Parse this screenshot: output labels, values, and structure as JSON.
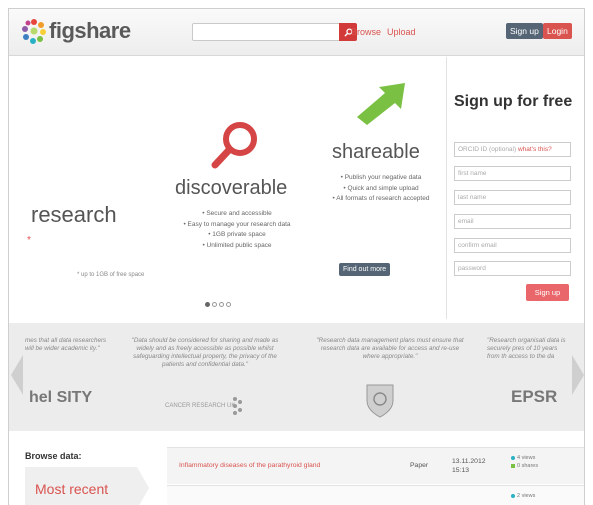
{
  "header": {
    "logo_text": "figshare",
    "search_placeholder": "",
    "browse_label": "Browse",
    "upload_label": "Upload",
    "signup_label": "Sign up",
    "login_label": "Login"
  },
  "hero": {
    "research": {
      "word": "research",
      "footnote": "* up to 1GB of free space"
    },
    "discoverable": {
      "word": "discoverable",
      "features": [
        "• Secure and accessible",
        "• Easy to manage your research data",
        "• 1GB private space",
        "• Unlimited public space"
      ]
    },
    "shareable": {
      "word": "shareable",
      "features": [
        "• Publish your negative data",
        "• Quick and simple upload",
        "• All formats of research accepted"
      ],
      "find_out_more": "Find out more"
    },
    "carousel": {
      "total": 4,
      "active": 1
    }
  },
  "signup": {
    "title": "Sign up for free",
    "fields": {
      "orcid": "ORCID ID (optional)",
      "orcid_link": "what's this?",
      "first_name": "first name",
      "last_name": "last name",
      "email": "email",
      "confirm_email": "confirm email",
      "password": "password"
    },
    "button": "Sign up"
  },
  "quotes": [
    {
      "text": "mes that all data researchers will be wider academic ity.\"",
      "logo": "hel SITY"
    },
    {
      "text": "\"Data should be considered for sharing and made as widely and as freely accessible as possible whilst safeguarding intellectual property, the privacy of the patients and confidential data.\"",
      "logo": "CANCER RESEARCH UK"
    },
    {
      "text": "\"Research data management plans must ensure that research data are available for access and re-use where appropriate.\"",
      "logo": ""
    },
    {
      "text": "\"Research organisati data is securely pres of 10 years from th access to the da",
      "logo": "EPSR"
    }
  ],
  "browse": {
    "label": "Browse data:",
    "tab": "Most recent",
    "rows": [
      {
        "title": "Inflammatory diseases of the parathyroid gland",
        "type": "Paper",
        "date": "13.11.2012",
        "time": "15:13",
        "views": "4 views",
        "shares": "0 shares"
      },
      {
        "title": "",
        "type": "",
        "date": "",
        "time": "",
        "views": "2 views",
        "shares": ""
      }
    ]
  },
  "colors": {
    "brand_red": "#d9534f",
    "dark_button": "#556575",
    "arrow_green": "#7ac143",
    "magnifier_red": "#d64545"
  }
}
